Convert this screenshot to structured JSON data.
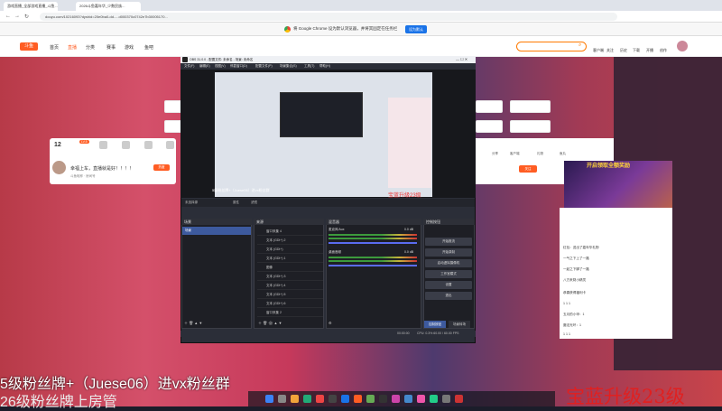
{
  "browser": {
    "tabs": [
      {
        "label": "游戏直播_全部游戏直播_斗鱼..."
      },
      {
        "label": "2026斗鱼嘉年华_少数民族..."
      }
    ],
    "url": "douyu.com/10216093?dyshid=20e0ba0-dd.....d000370c0742e7b30005170...",
    "default_prompt": "将 Google Chrome 设为默认浏览器，并将其固定在任务栏",
    "default_button": "设为默认"
  },
  "nav": {
    "logo": "斗鱼",
    "items": [
      "首页",
      "直播",
      "分类",
      "赛事",
      "游戏",
      "鱼吧"
    ],
    "right_items": [
      "客户端",
      "关注",
      "历史",
      "下载",
      "开播",
      "创作"
    ]
  },
  "room": {
    "level": "12",
    "streamer_badge": "LV.5",
    "title": "幸福上车，直播就是好！！！！",
    "id_line": "斗鱼昵称 · 房间号",
    "hot_value": "热度",
    "buttons": [
      "分享",
      "客户端",
      "关注"
    ],
    "right_tags": [
      "分享",
      "客户端",
      "礼物",
      "鱼丸"
    ]
  },
  "obs": {
    "title": "OBS 31.0.0 - 配置文件: 未命名 - 场景: 未命名",
    "menu": [
      "文件(F)",
      "编辑(E)",
      "视图(V)",
      "停靠窗口(D)",
      "配置文件(P)",
      "场景集合(S)",
      "工具(T)",
      "帮助(H)"
    ],
    "preview_caption": "5级粉丝牌+（Juese06）进vx粉丝群",
    "preview_caption_red": "宝蓝升级23级",
    "toolbar": [
      "属性",
      "滤镜"
    ],
    "no_source": "未选择源",
    "panels": {
      "scenes": "场景",
      "sources": "来源",
      "mixer": "混音器",
      "controls": "控制按钮"
    },
    "scene_items": [
      "场景"
    ],
    "sources": [
      "窗口采集 4",
      "文本 (GDI+) 2",
      "文本 (GDI+)",
      "文本 (GDI+) 1",
      "图像",
      "文本 (GDI+) 3",
      "文本 (GDI+) 4",
      "文本 (GDI+) 5",
      "文本 (GDI+) 6",
      "窗口采集 2"
    ],
    "mixer_channels": [
      {
        "label": "麦克风/Aux",
        "db": "0.0 dB"
      },
      {
        "label": "桌面音频",
        "db": "0.0 dB"
      }
    ],
    "controls": [
      "开始推流",
      "开始录制",
      "启动虚拟摄像机",
      "工作室模式",
      "设置",
      "退出"
    ],
    "bottom_tabs": [
      "控制按钮",
      "场景转场"
    ],
    "status": "CPU: 0.3%  60.00 / 60.00 FPS",
    "status_time": "00:00:00"
  },
  "chat": {
    "ad_title": "开启领取全额奖励",
    "rows": [
      "红包：送出了嘉年华礼物",
      "一气之下上了一路",
      "一起之下脚了一路",
      "八方来财小精灵",
      "恭喜获得福利卡",
      "1 1 1",
      "五月的小甲：1",
      "魔法光环：1",
      "1 1 1"
    ]
  },
  "subtitles": {
    "line1": "5级粉丝牌+（Juese06）进vx粉丝群",
    "line2": "26级粉丝牌上房管",
    "line3": "宝蓝升级23级 "
  },
  "colors": {
    "accent": "#ff5d23",
    "chrome_button": "#1a73e8",
    "obs_bg": "#2b2e38",
    "subtitle_red": "#e02020"
  }
}
